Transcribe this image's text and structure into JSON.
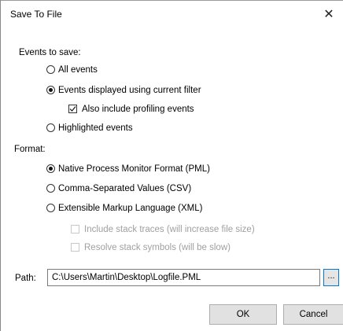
{
  "window": {
    "title": "Save To File",
    "close_glyph": "✕"
  },
  "events_group": {
    "label": "Events to save:",
    "options": [
      {
        "label": "All events",
        "checked": false
      },
      {
        "label": "Events displayed using current filter",
        "checked": true
      },
      {
        "label": "Highlighted events",
        "checked": false
      }
    ],
    "include_profiling": {
      "label": "Also include profiling events",
      "checked": true
    }
  },
  "format_group": {
    "label": "Format:",
    "options": [
      {
        "label": "Native Process Monitor Format (PML)",
        "checked": true
      },
      {
        "label": "Comma-Separated Values (CSV)",
        "checked": false
      },
      {
        "label": "Extensible Markup Language (XML)",
        "checked": false
      }
    ],
    "xml_options": [
      {
        "label": "Include stack traces (will increase file size)",
        "checked": false,
        "enabled": false
      },
      {
        "label": "Resolve stack symbols (will be slow)",
        "checked": false,
        "enabled": false
      }
    ]
  },
  "path": {
    "label": "Path:",
    "value": "C:\\Users\\Martin\\Desktop\\Logfile.PML",
    "browse_label": "..."
  },
  "buttons": {
    "ok": "OK",
    "cancel": "Cancel"
  },
  "colors": {
    "focus_border": "#0078d7",
    "disabled_text": "#a0a0a0"
  }
}
